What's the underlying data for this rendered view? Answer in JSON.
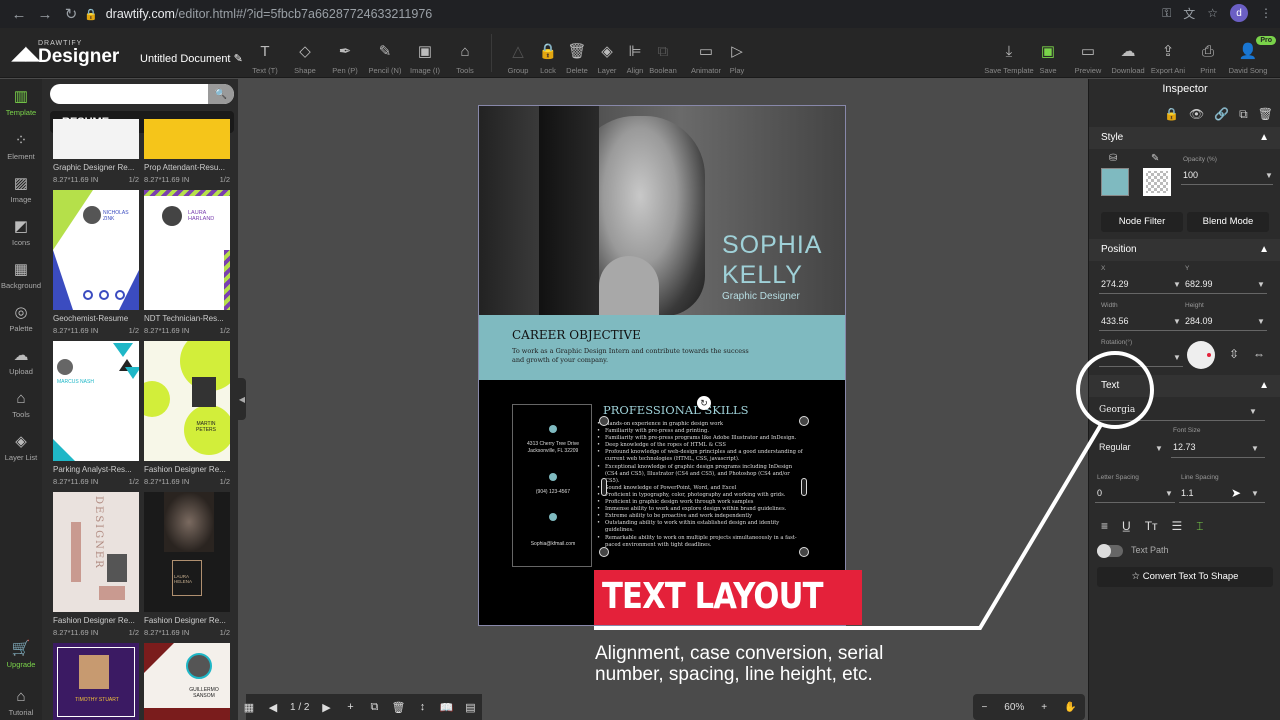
{
  "browser": {
    "url_host": "drawtify.com",
    "url_path": "/editor.html#/?id=5fbcb7a66287724633211976",
    "profile_initial": "d"
  },
  "app": {
    "logo_small": "DRAWTIFY",
    "logo_big": "Designer",
    "document_title": "Untitled Document"
  },
  "toolbar": {
    "tools": [
      {
        "icon": "text-icon",
        "label": "Text (T)"
      },
      {
        "icon": "shape-icon",
        "label": "Shape"
      },
      {
        "icon": "pen-icon",
        "label": "Pen (P)"
      },
      {
        "icon": "pencil-icon",
        "label": "Pencil (N)"
      },
      {
        "icon": "image-icon",
        "label": "Image (I)"
      },
      {
        "icon": "tools-icon",
        "label": "Tools"
      },
      {
        "icon": "group-icon",
        "label": "Group"
      },
      {
        "icon": "lock-icon",
        "label": "Lock"
      },
      {
        "icon": "delete-icon",
        "label": "Delete"
      },
      {
        "icon": "layer-icon",
        "label": "Layer"
      },
      {
        "icon": "align-icon",
        "label": "Align"
      },
      {
        "icon": "boolean-icon",
        "label": "Boolean"
      },
      {
        "icon": "animator-icon",
        "label": "Animator"
      },
      {
        "icon": "play-icon",
        "label": "Play"
      }
    ],
    "right": [
      {
        "icon": "save-template-icon",
        "label": "Save Template"
      },
      {
        "icon": "save-icon",
        "label": "Save"
      },
      {
        "icon": "preview-icon",
        "label": "Preview"
      },
      {
        "icon": "download-icon",
        "label": "Download"
      },
      {
        "icon": "export-icon",
        "label": "Export Ani"
      },
      {
        "icon": "print-icon",
        "label": "Print"
      },
      {
        "icon": "user-icon",
        "label": "David Song"
      }
    ],
    "pro_badge": "Pro"
  },
  "rail": [
    {
      "label": "Template",
      "icon": "template-icon"
    },
    {
      "label": "Element",
      "icon": "element-icon"
    },
    {
      "label": "Image",
      "icon": "image-icon"
    },
    {
      "label": "Icons",
      "icon": "icons-icon"
    },
    {
      "label": "Background",
      "icon": "background-icon"
    },
    {
      "label": "Palette",
      "icon": "palette-icon"
    },
    {
      "label": "Upload",
      "icon": "upload-icon"
    },
    {
      "label": "Tools",
      "icon": "tools-icon"
    },
    {
      "label": "Layer List",
      "icon": "layer-list-icon"
    },
    {
      "label": "Upgrade",
      "icon": "cart-icon"
    },
    {
      "label": "Tutorial",
      "icon": "tutorial-icon"
    }
  ],
  "templates": {
    "category": "RESUME",
    "items": [
      {
        "name": "Graphic Designer Re...",
        "size": "8.27*11.69 IN",
        "pages": "1/2"
      },
      {
        "name": "Prop Attendant-Resu...",
        "size": "8.27*11.69 IN",
        "pages": "1/2"
      },
      {
        "name": "Geochemist-Resume",
        "size": "8.27*11.69 IN",
        "pages": "1/2"
      },
      {
        "name": "NDT Technician-Res...",
        "size": "8.27*11.69 IN",
        "pages": "1/2"
      },
      {
        "name": "Parking Analyst-Res...",
        "size": "8.27*11.69 IN",
        "pages": "1/2"
      },
      {
        "name": "Fashion Designer Re...",
        "size": "8.27*11.69 IN",
        "pages": "1/2"
      },
      {
        "name": "Fashion Designer Re...",
        "size": "8.27*11.69 IN",
        "pages": "1/2"
      },
      {
        "name": "Fashion Designer Re...",
        "size": "8.27*11.69 IN",
        "pages": "1/2"
      }
    ],
    "thumb_texts": {
      "nicholas": "NICHOLAS ZINK",
      "laura": "LAURA HARLAND",
      "marcus": "MARCUS NASH",
      "martin": "MARTIN PETERS",
      "designer": "DESIGNER",
      "laura_helena": "LAURA HELENA",
      "timothy": "TIMOTHY STUART",
      "guillermo": "GUILLERMO SANSOM"
    }
  },
  "resume": {
    "first_name": "SOPHIA",
    "last_name": "KELLY",
    "role": "Graphic Designer",
    "objective_title": "CAREER OBJECTIVE",
    "objective_text": "To work as a Graphic Design Intern and contribute towards the success and growth of your company.",
    "address": "4313 Cherry Tree Drive Jacksonville, FL 32209",
    "phone": "(904) 123-4567",
    "email": "Sophia@kfmail.com",
    "skills_title": "PROFESSIONAL SKILLS",
    "skills": [
      "Hands-on experience in graphic design work",
      "Familiarity with pre-press and printing.",
      "Familiarity with pre-press programs like Adobe Illustrator and InDesign.",
      "Deep knowledge of the ropes of HTML & CSS",
      "Profound knowledge of web-design principles and a good understanding of current web technologies (HTML, CSS, javascript).",
      "Exceptional knowledge of graphic design programs including InDesign (CS4 and CS5), Illustrator (CS4 and CS5), and Photoshop (CS4 and/or CS5).",
      "Sound knowledge of PowerPoint, Word, and Excel",
      "Proficient in typography, color, photography and working with grids.",
      "Proficient in graphic design work through work samples",
      "Immense ability to work and explore design within brand guidelines.",
      "Extreme ability to be proactive and work independently",
      "Outstanding ability to work within established design and identity guidelines.",
      "Remarkable ability to work on multiple projects simultaneously in a fast-paced environment with tight deadlines."
    ]
  },
  "overlay": {
    "title": "TEXT LAYOUT",
    "caption_line1": "Alignment, case conversion, serial",
    "caption_line2": "number, spacing, line height, etc."
  },
  "canvas_bar": {
    "page_indicator": "1 / 2",
    "zoom": "60%"
  },
  "inspector": {
    "title": "Inspector",
    "style": {
      "heading": "Style",
      "opacity_label": "Opacity (%)",
      "opacity_value": "100",
      "fill_color": "#7fbac0",
      "node_filter": "Node Filter",
      "blend_mode": "Blend Mode"
    },
    "position": {
      "heading": "Position",
      "x_label": "X",
      "x_value": "274.29",
      "y_label": "Y",
      "y_value": "682.99",
      "width_label": "Width",
      "width_value": "433.56",
      "height_label": "Height",
      "height_value": "284.09",
      "rotation_label": "Rotation(°)"
    },
    "text": {
      "heading": "Text",
      "font": "Georgia",
      "weight": "Regular",
      "font_size_label": "Font Size",
      "font_size": "12.73",
      "letter_spacing_label": "Letter Spacing",
      "letter_spacing": "0",
      "line_spacing_label": "Line Spacing",
      "line_spacing": "1.1",
      "text_path": "Text Path",
      "convert": "Convert Text To Shape"
    }
  }
}
